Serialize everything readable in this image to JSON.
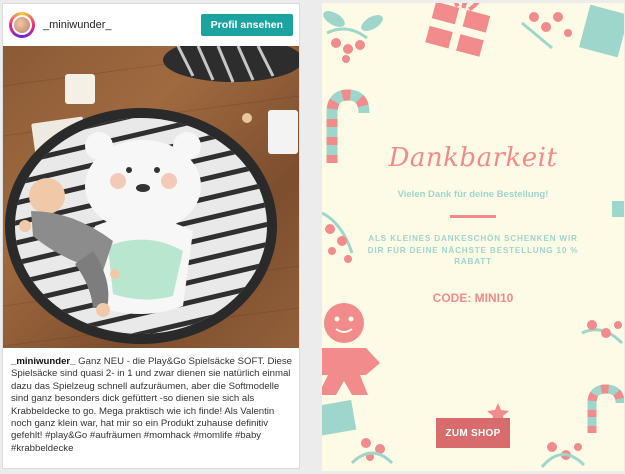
{
  "instagram": {
    "username": "_miniwunder_",
    "profile_button": "Profil ansehen",
    "caption_user": "_miniwunder_",
    "caption_text": " Ganz NEU - die Play&Go Spielsäcke SOFT. Diese Spielsäcke sind quasi 2- in 1 und zwar dienen sie natürlich einmal dazu das Spielzeug schnell aufzuräumen, aber die Softmodelle sind ganz besonders dick gefüttert -so dienen sie sich als Krabbeldecke to go. Mega praktisch wie ich finde! Als Valentin noch ganz klein war, hat mir so ein Produkt zuhause definitiv gefehlt! #play&Go #aufräumen #momhack #momlife #baby #krabbeldecke"
  },
  "thanks": {
    "title": "Dankbarkeit",
    "subtitle": "Vielen Dank für deine Bestellung!",
    "discount_text": "ALS KLEINES DANKESCHÖN SCHENKEN WIR DIR FÜR DEINE NÄCHSTE BESTELLUNG 10 % RABATT",
    "code": "CODE: MINI10",
    "shop_button": "ZUM SHOP"
  },
  "colors": {
    "accent_teal": "#1aa3a0",
    "pink": "#f28b8b",
    "mint": "#9fd6cc",
    "cream": "#fdfbe6",
    "button_red": "#d86b6b"
  }
}
